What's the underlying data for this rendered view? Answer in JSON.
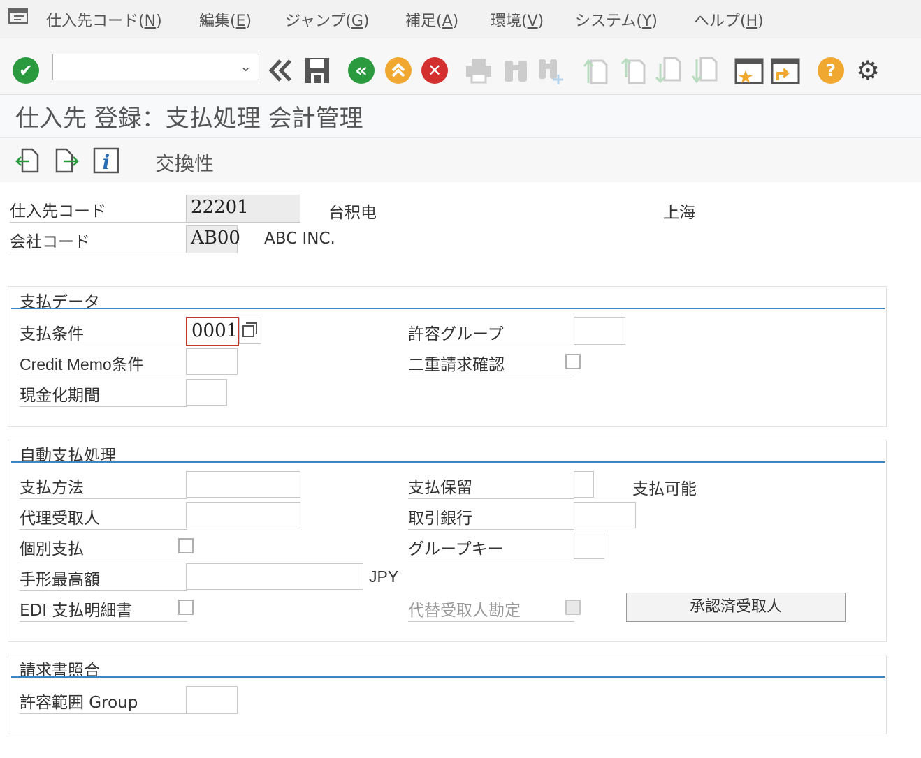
{
  "menu": {
    "items": [
      {
        "label": "仕入先コード(",
        "key": "N",
        "end": ")"
      },
      {
        "label": "編集(",
        "key": "E",
        "end": ")"
      },
      {
        "label": "ジャンプ(",
        "key": "G",
        "end": ")"
      },
      {
        "label": "補足(",
        "key": "A",
        "end": ")"
      },
      {
        "label": "環境(",
        "key": "V",
        "end": ")"
      },
      {
        "label": "システム(",
        "key": "Y",
        "end": ")"
      },
      {
        "label": "ヘルプ(",
        "key": "H",
        "end": ")"
      }
    ]
  },
  "toolbar": {
    "command_value": "",
    "icons": {
      "enter": "✔",
      "back": "«",
      "exit": "⌃",
      "cancel": "✕",
      "help": "?",
      "settings": "⚙"
    },
    "colors": {
      "enter": "#2b9a3f",
      "back": "#2b9a3f",
      "exit": "#f0a830",
      "cancel": "#d32f2f",
      "help": "#f0a830"
    }
  },
  "page": {
    "title": "仕入先 登録：支払処理 会計管理",
    "app_toolbar_label": "交換性"
  },
  "header": {
    "vendor_label": "仕入先コード",
    "vendor_value": "22201",
    "vendor_name": "台积电",
    "vendor_city": "上海",
    "company_label": "会社コード",
    "company_value": "AB00",
    "company_name": "ABC INC."
  },
  "payment_data": {
    "title": "支払データ",
    "terms_label": "支払条件",
    "terms_value": "0001",
    "credit_memo_label": "Credit Memo条件",
    "credit_memo_value": "",
    "check_cashing_label": "現金化期間",
    "check_cashing_value": "",
    "tolerance_group_label": "許容グループ",
    "tolerance_group_value": "",
    "double_invoice_label": "二重請求確認",
    "double_invoice_checked": false
  },
  "auto_payment": {
    "title": "自動支払処理",
    "method_label": "支払方法",
    "method_value": "",
    "alt_payee_label": "代理受取人",
    "alt_payee_value": "",
    "individual_label": "個別支払",
    "individual_checked": false,
    "bill_limit_label": "手形最高額",
    "bill_limit_value": "",
    "currency": "JPY",
    "edi_label": "EDI 支払明細書",
    "edi_checked": false,
    "block_label": "支払保留",
    "block_value": "",
    "block_text": "支払可能",
    "house_bank_label": "取引銀行",
    "house_bank_value": "",
    "grouping_key_label": "グループキー",
    "grouping_key_value": "",
    "alt_payee_doc_label": "代替受取人勘定",
    "alt_payee_doc_checked": false,
    "approved_button": "承認済受取人"
  },
  "invoice_verification": {
    "title": "請求書照合",
    "tolerance_label": "許容範囲 Group",
    "tolerance_value": ""
  }
}
